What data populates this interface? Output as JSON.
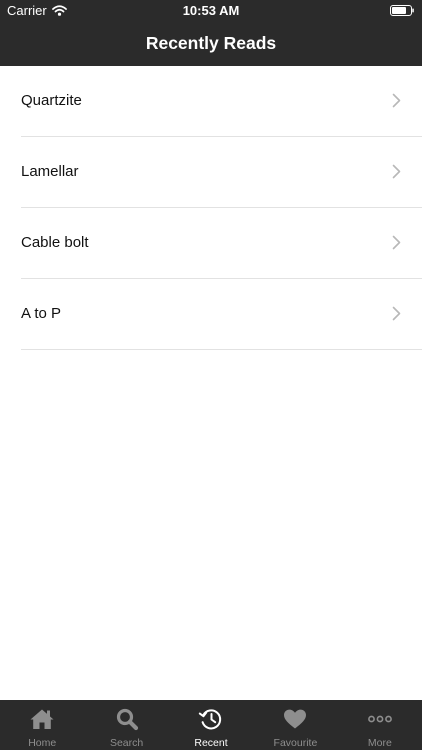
{
  "status_bar": {
    "carrier": "Carrier",
    "time": "10:53 AM"
  },
  "nav": {
    "title": "Recently Reads"
  },
  "list": {
    "items": [
      {
        "label": "Quartzite"
      },
      {
        "label": "Lamellar"
      },
      {
        "label": "Cable bolt"
      },
      {
        "label": "A to P"
      }
    ]
  },
  "tabbar": {
    "tabs": [
      {
        "label": "Home",
        "icon": "home-icon"
      },
      {
        "label": "Search",
        "icon": "search-icon"
      },
      {
        "label": "Recent",
        "icon": "history-icon",
        "active": true
      },
      {
        "label": "Favourite",
        "icon": "heart-icon"
      },
      {
        "label": "More",
        "icon": "more-icon"
      }
    ]
  },
  "colors": {
    "bar_background": "#2b2b2b",
    "active_tab": "#ffffff",
    "inactive_tab": "#8e8e8e",
    "separator": "#e2e2e2"
  }
}
